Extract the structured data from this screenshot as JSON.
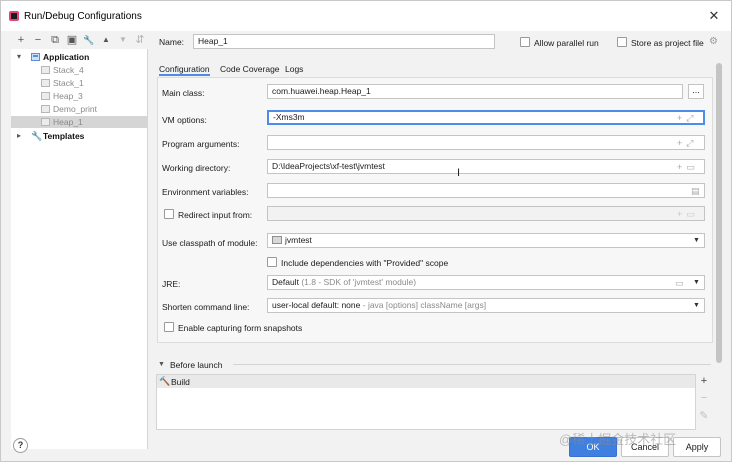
{
  "window": {
    "title": "Run/Debug Configurations",
    "close_glyph": "✕"
  },
  "left_toolbar": [
    {
      "name": "add-icon",
      "glyph": "+"
    },
    {
      "name": "remove-icon",
      "glyph": "−"
    },
    {
      "name": "copy-icon",
      "glyph": "⧉"
    },
    {
      "name": "save-icon",
      "glyph": "▣"
    },
    {
      "name": "wrench-icon",
      "glyph": "🔧"
    },
    {
      "name": "move-up-icon",
      "glyph": "▲"
    },
    {
      "name": "move-down-icon",
      "glyph": "▼"
    },
    {
      "name": "sort-icon",
      "glyph": "⇵"
    }
  ],
  "tree": {
    "application": {
      "label": "Application",
      "expanded": true
    },
    "children": [
      "Stack_4",
      "Stack_1",
      "Heap_3",
      "Demo_print",
      "Heap_1"
    ],
    "selected": "Heap_1",
    "templates": {
      "label": "Templates",
      "expanded": false
    }
  },
  "header": {
    "name_label": "Name:",
    "name_value": "Heap_1",
    "allow_parallel_label": "Allow parallel run",
    "store_project_label": "Store as project file"
  },
  "tabs": [
    "Configuration",
    "Code Coverage",
    "Logs"
  ],
  "active_tab": "Configuration",
  "form": {
    "main_class_label": "Main class:",
    "main_class_value": "com.huawei.heap.Heap_1",
    "browse_label": "...",
    "vm_options_label": "VM options:",
    "vm_options_value": "-Xms3m",
    "program_args_label": "Program arguments:",
    "program_args_value": "",
    "working_dir_label": "Working directory:",
    "working_dir_value": "D:\\IdeaProjects\\xf-test\\jvmtest",
    "env_vars_label": "Environment variables:",
    "env_vars_value": "",
    "redirect_label": "Redirect input from:",
    "classpath_label": "Use classpath of module:",
    "classpath_value": "jvmtest",
    "include_deps_label": "Include dependencies with \"Provided\" scope",
    "jre_label": "JRE:",
    "jre_value": "Default",
    "jre_detail": "(1.8 - SDK of 'jvmtest' module)",
    "shorten_label": "Shorten command line:",
    "shorten_value": "user-local default: none",
    "shorten_detail": "- java [options] className [args]",
    "capture_label": "Enable capturing form snapshots"
  },
  "before_launch": {
    "label": "Before launch",
    "items": [
      "Build"
    ]
  },
  "buttons": {
    "ok": "OK",
    "cancel": "Cancel",
    "apply": "Apply",
    "help": "?"
  },
  "watermark": "@稀土掘金技术社区",
  "colors": {
    "accent": "#4d8ce8",
    "selection": "#d5d5d5"
  }
}
